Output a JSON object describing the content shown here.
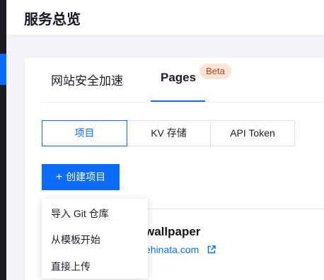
{
  "header": {
    "title": "服务总览"
  },
  "main_tabs": [
    {
      "label": "网站安全加速"
    },
    {
      "label": "Pages",
      "badge": "Beta"
    }
  ],
  "sub_tabs": [
    {
      "label": "项目"
    },
    {
      "label": "KV 存储"
    },
    {
      "label": "API Token"
    }
  ],
  "create_button": {
    "icon": "plus-icon",
    "label": "创建项目"
  },
  "project": {
    "name": "wallpaper",
    "domain": "ehinata.com",
    "link_icon": "external-link-icon"
  },
  "dropdown": {
    "items": [
      {
        "label": "导入 Git 仓库"
      },
      {
        "label": "从模板开始"
      },
      {
        "label": "直接上传"
      }
    ]
  },
  "colors": {
    "accent": "#0a6cff",
    "sidebar": "#1a1c21",
    "badge_bg": "#fbe4d6",
    "badge_text": "#b4441c"
  }
}
